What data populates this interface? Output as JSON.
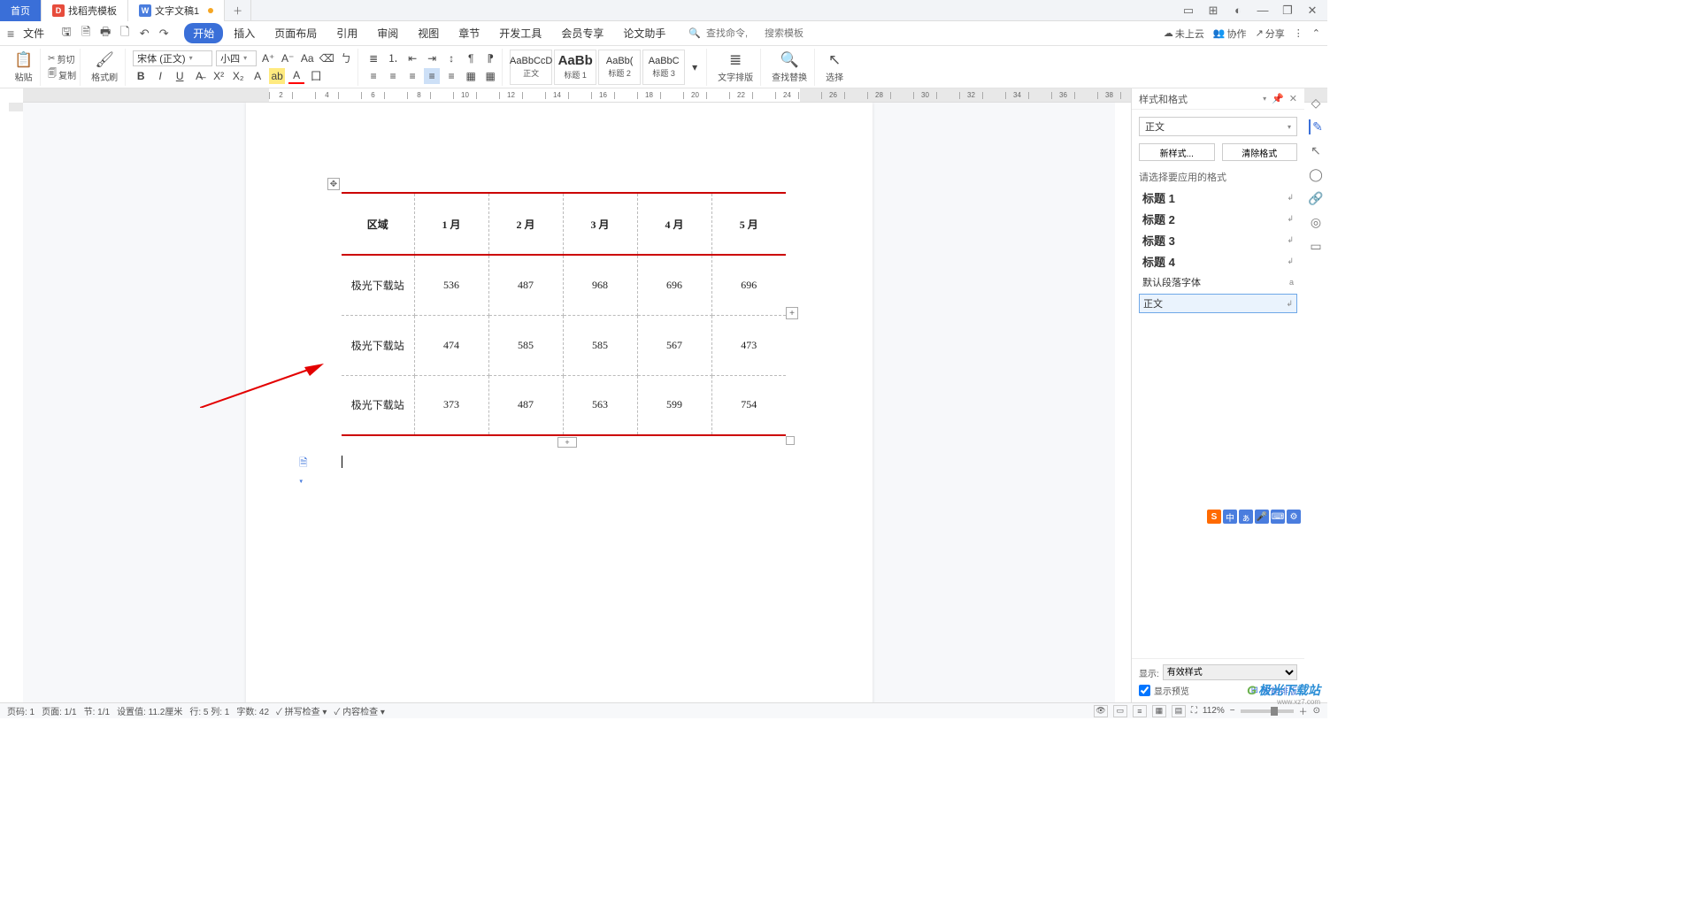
{
  "tabs": {
    "home": "首页",
    "docer": "找稻壳模板",
    "current": "文字文稿1"
  },
  "menubar": {
    "file": "文件",
    "items": [
      "开始",
      "插入",
      "页面布局",
      "引用",
      "审阅",
      "视图",
      "章节",
      "开发工具",
      "会员专享",
      "论文助手"
    ],
    "search_cmd": "查找命令,",
    "search_tpl": "搜索模板",
    "cloud": "未上云",
    "coop": "协作",
    "share": "分享"
  },
  "ribbon": {
    "paste": "粘贴",
    "cut": "剪切",
    "copy": "复制",
    "fmtpaint": "格式刷",
    "font_name": "宋体 (正文)",
    "font_size": "小四",
    "styles": [
      {
        "preview": "AaBbCcD",
        "label": "正文"
      },
      {
        "preview": "AaBb",
        "label": "标题 1"
      },
      {
        "preview": "AaBb(",
        "label": "标题 2"
      },
      {
        "preview": "AaBbC",
        "label": "标题 3"
      }
    ],
    "layout": "文字排版",
    "find": "查找替换",
    "select": "选择"
  },
  "chart_data": {
    "type": "table",
    "headers": [
      "区域",
      "1 月",
      "2 月",
      "3 月",
      "4 月",
      "5 月"
    ],
    "rows": [
      [
        "极光下载站",
        "536",
        "487",
        "968",
        "696",
        "696"
      ],
      [
        "极光下载站",
        "474",
        "585",
        "585",
        "567",
        "473"
      ],
      [
        "极光下载站",
        "373",
        "487",
        "563",
        "599",
        "754"
      ]
    ]
  },
  "panel": {
    "title": "样式和格式",
    "current_style": "正文",
    "new_style": "新样式...",
    "clear": "清除格式",
    "prompt": "请选择要应用的格式",
    "list": [
      "标题 1",
      "标题 2",
      "标题 3",
      "标题 4"
    ],
    "default_font": "默认段落字体",
    "body": "正文",
    "show_label": "显示:",
    "show_value": "有效样式",
    "preview_chk": "显示预览",
    "smart_layout": "智能排版"
  },
  "status": {
    "page_code": "页码: 1",
    "page": "页面: 1/1",
    "sec": "节: 1/1",
    "pos": "设置值: 11.2厘米",
    "line": "行: 5  列: 1",
    "words": "字数: 42",
    "spell": "拼写检查",
    "content": "内容检查",
    "zoom": "112%"
  },
  "ime": {
    "chars": [
      "中",
      "ぁ",
      "",
      "",
      ""
    ]
  },
  "watermark": {
    "text": "极光下载站",
    "url": "www.xz7.com"
  }
}
